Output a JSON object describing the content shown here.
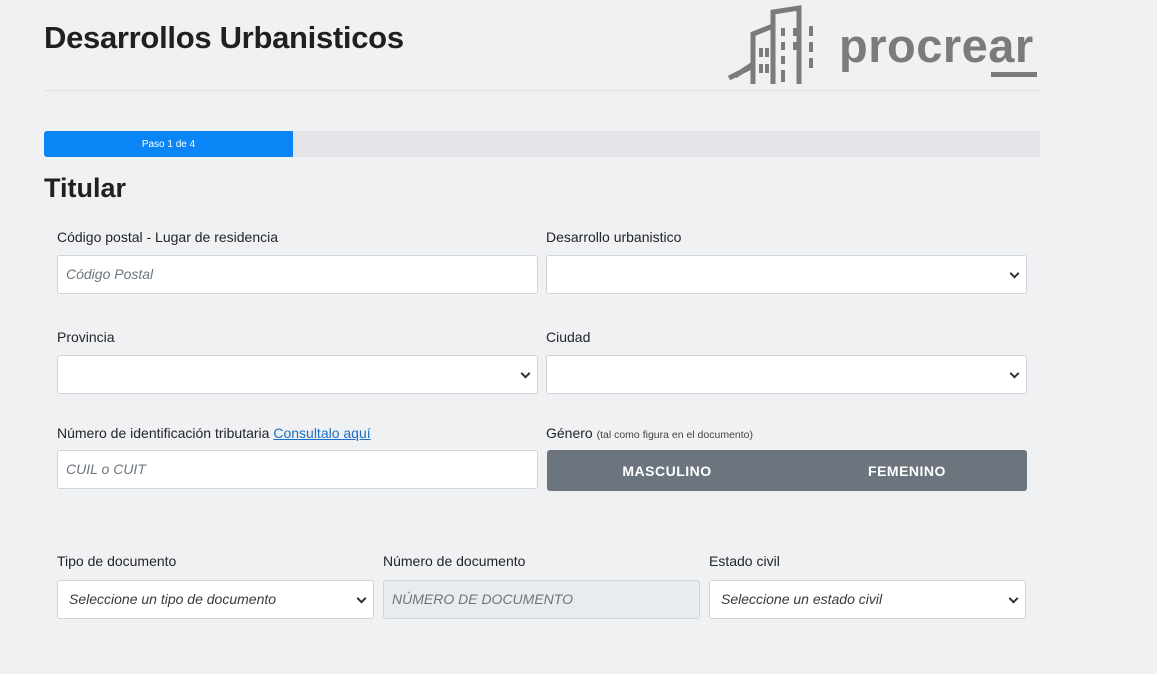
{
  "header": {
    "title": "Desarrollos Urbanisticos",
    "logo_text": "procrear",
    "logo_icon": "buildings-logo-icon"
  },
  "progress": {
    "label": "Paso 1 de 4",
    "step": 1,
    "total_steps": 4,
    "fraction": 0.25,
    "color": "#0b84f6"
  },
  "form": {
    "section_title": "Titular",
    "postal_code": {
      "label": "Código postal - Lugar de residencia",
      "placeholder": "Código Postal",
      "value": ""
    },
    "development": {
      "label": "Desarrollo urbanistico",
      "value": ""
    },
    "province": {
      "label": "Provincia",
      "value": ""
    },
    "city": {
      "label": "Ciudad",
      "value": ""
    },
    "tax_id": {
      "label": "Número de identificación tributaria",
      "link": "Consultalo aquí",
      "placeholder": "CUIL o CUIT",
      "value": ""
    },
    "gender": {
      "label": "Género",
      "hint": "(tal como figura en el documento)",
      "options": [
        "MASCULINO",
        "FEMENINO"
      ]
    },
    "doc_type": {
      "label": "Tipo de documento",
      "value": "Seleccione un tipo de documento"
    },
    "doc_number": {
      "label": "Número de documento",
      "placeholder": "NÚMERO DE DOCUMENTO",
      "value": ""
    },
    "civil_status": {
      "label": "Estado civil",
      "value": "Seleccione un estado civil"
    }
  }
}
